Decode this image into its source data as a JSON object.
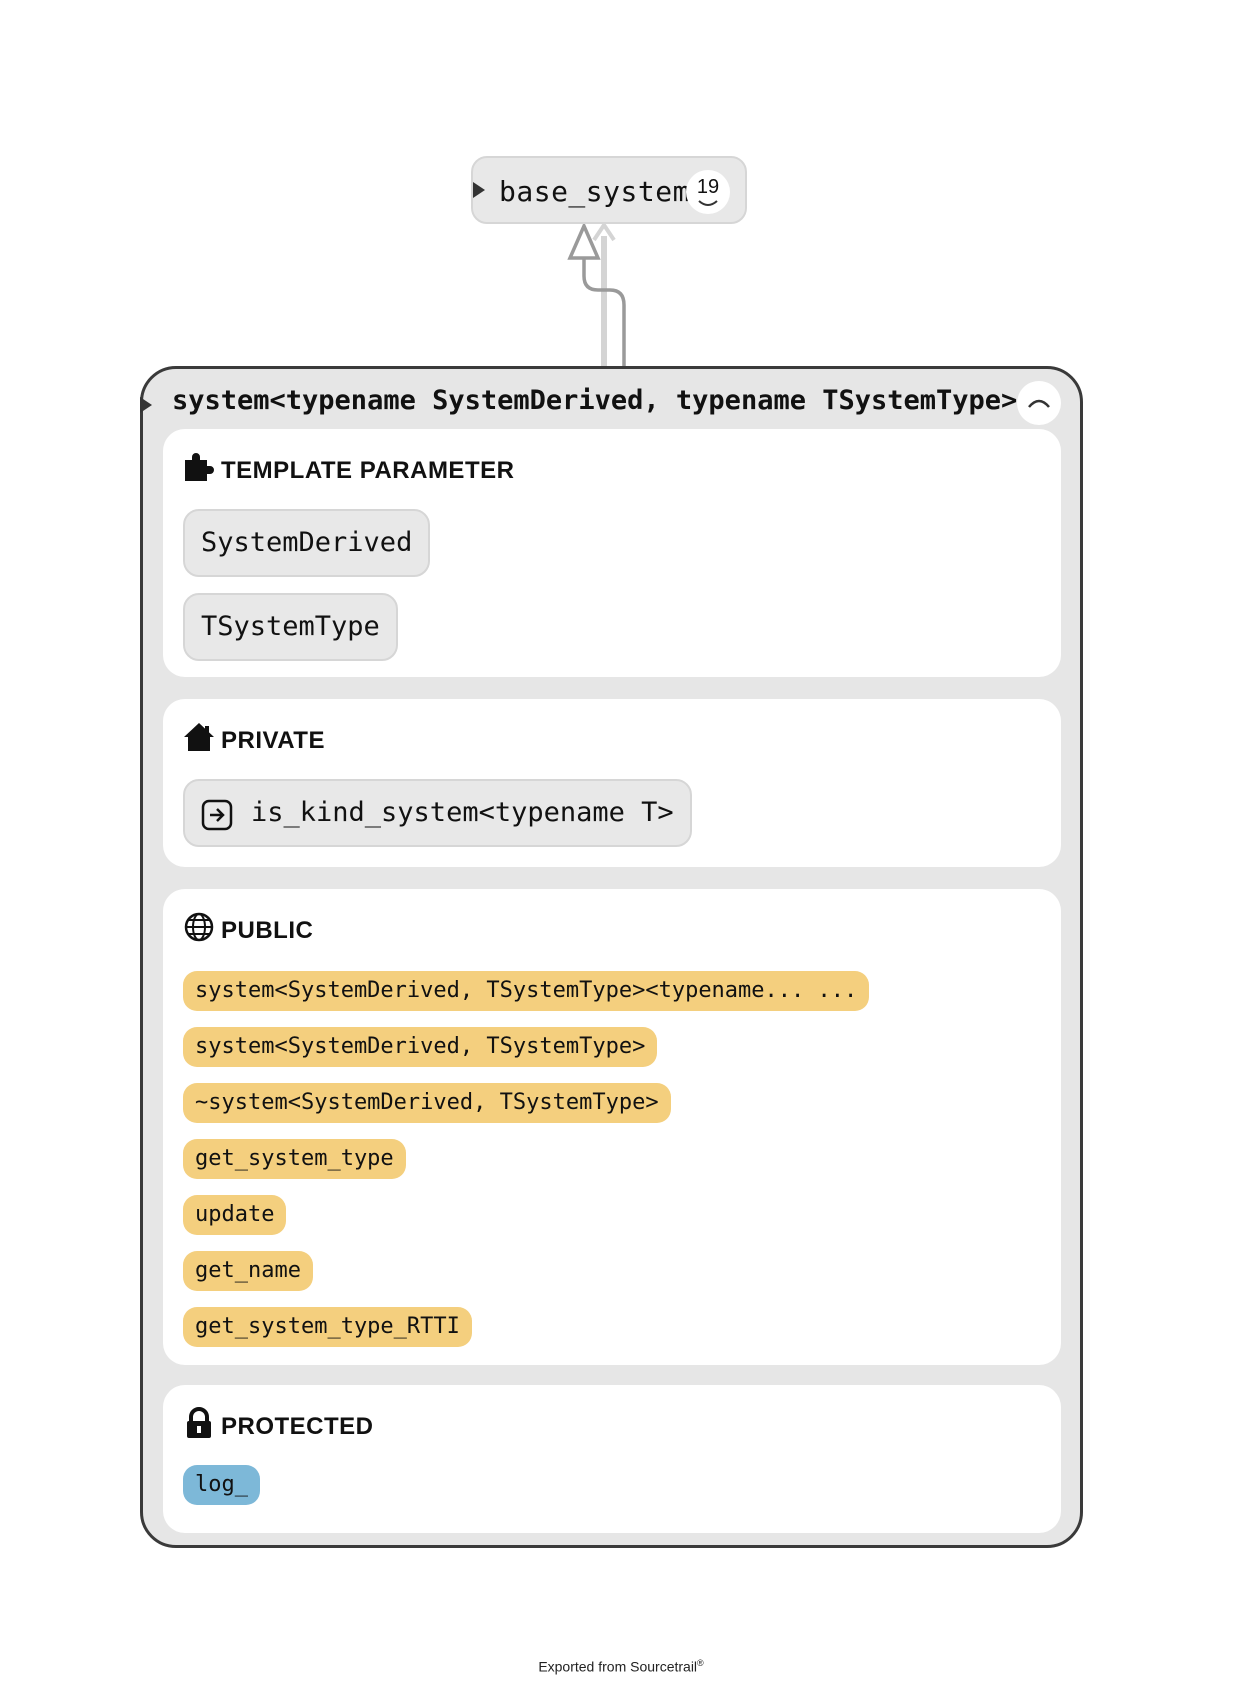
{
  "base_node": {
    "label": "base_system",
    "count": "19"
  },
  "class_node": {
    "title": "system<typename SystemDerived, typename TSystemType>",
    "sections": {
      "template_parameter": {
        "title": "TEMPLATE PARAMETER",
        "items": [
          "SystemDerived",
          "TSystemType"
        ]
      },
      "private": {
        "title": "PRIVATE",
        "items": [
          "is_kind_system<typename T>"
        ]
      },
      "public": {
        "title": "PUBLIC",
        "items": [
          "system<SystemDerived, TSystemType><typename... ...",
          "system<SystemDerived, TSystemType>",
          "~system<SystemDerived, TSystemType>",
          "get_system_type",
          "update",
          "get_name",
          "get_system_type_RTTI"
        ]
      },
      "protected": {
        "title": "PROTECTED",
        "items": [
          "log_"
        ]
      }
    }
  },
  "footer": {
    "text": "Exported from Sourcetrail",
    "mark": "®"
  },
  "colors": {
    "function_fill": "#f4cf7e",
    "field_fill": "#7db8d8",
    "node_fill": "#e8e8e8",
    "class_border": "#3a3a3a",
    "edge": "#9a9a9a",
    "edge_light": "#d4d4d4"
  }
}
